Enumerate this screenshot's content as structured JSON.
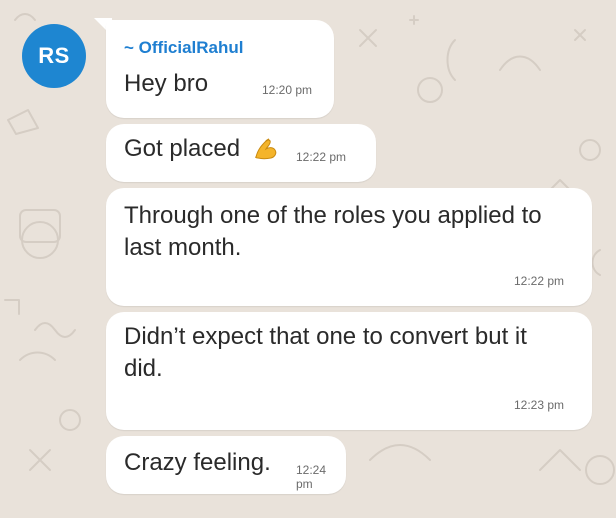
{
  "avatar": {
    "initials": "RS",
    "color": "#1e86d1"
  },
  "messages": [
    {
      "sender": "~ OfficialRahul",
      "text": "Hey bro",
      "time": "12:20 pm"
    },
    {
      "text": "Got placed",
      "emoji": "flexed-biceps-icon",
      "time": "12:22 pm"
    },
    {
      "text_lines": [
        "Through one of the roles you applied to",
        "last month."
      ],
      "time": "12:22 pm"
    },
    {
      "text_lines": [
        "Didn’t expect that one to convert but it",
        "did."
      ],
      "time": "12:23 pm"
    },
    {
      "text": "Crazy feeling.",
      "time": "12:24 pm"
    }
  ],
  "colors": {
    "background": "#e9e2da",
    "bubble": "#ffffff",
    "sender": "#1f7fd1",
    "time": "#6b6b6b"
  }
}
